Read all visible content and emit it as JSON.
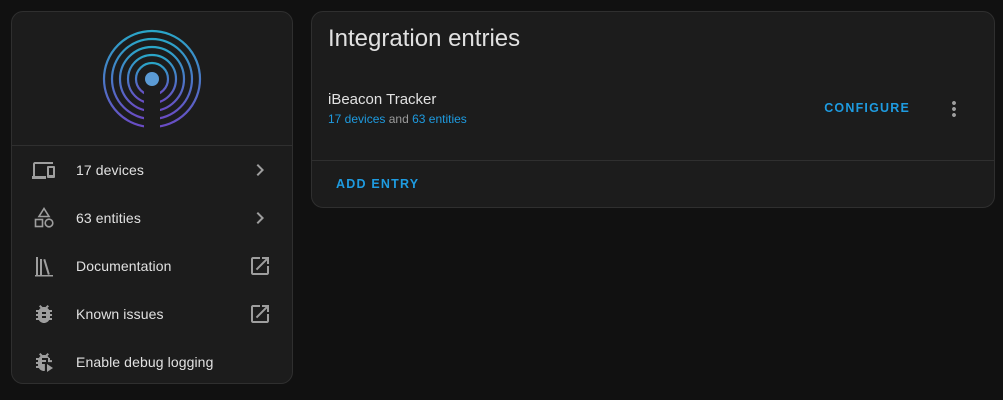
{
  "colors": {
    "background": "#111111",
    "card": "#1c1c1c",
    "accent": "#1e9be0",
    "text": "#e1e1e1",
    "icon": "#9e9e9e",
    "logo_outer": "#2aa6c8",
    "logo_inner": "#6a4bc4"
  },
  "sidebar": {
    "logo_icon": "ibeacon-logo",
    "items": [
      {
        "label": "17 devices",
        "icon": "devices-icon",
        "trailing": "chevron-right-icon"
      },
      {
        "label": "63 entities",
        "icon": "shapes-icon",
        "trailing": "chevron-right-icon"
      },
      {
        "label": "Documentation",
        "icon": "bookshelf-icon",
        "trailing": "open-in-new-icon"
      },
      {
        "label": "Known issues",
        "icon": "bug-icon",
        "trailing": "open-in-new-icon"
      },
      {
        "label": "Enable debug logging",
        "icon": "bug-play-icon",
        "trailing": ""
      }
    ]
  },
  "main": {
    "title": "Integration entries",
    "entry": {
      "name": "iBeacon Tracker",
      "devices_link": "17 devices",
      "connector": "and",
      "entities_link": "63 entities",
      "configure_label": "CONFIGURE"
    },
    "add_entry_label": "ADD ENTRY"
  }
}
